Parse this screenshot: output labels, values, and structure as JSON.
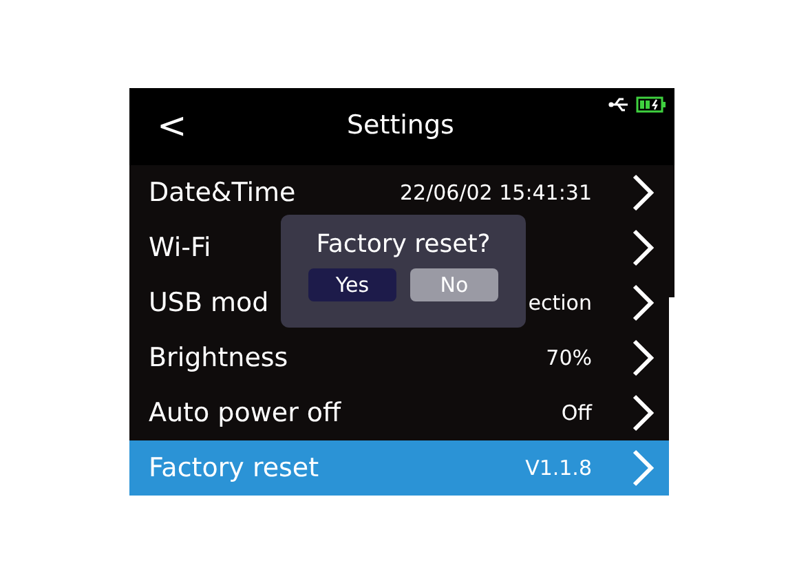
{
  "header": {
    "back": "<",
    "title": "Settings"
  },
  "rows": [
    {
      "label": "Date&Time",
      "value": "22/06/02 15:41:31",
      "selected": false
    },
    {
      "label": "Wi-Fi",
      "selected": false
    },
    {
      "label": "USB mod",
      "value": "ection",
      "selected": false
    },
    {
      "label": "Brightness",
      "value": "70%",
      "selected": false
    },
    {
      "label": "Auto power off",
      "value": "Off",
      "selected": false
    },
    {
      "label": "Factory reset",
      "value": "V1.1.8",
      "selected": true
    }
  ],
  "dialog": {
    "title": "Factory reset?",
    "buttons": [
      {
        "label": "Yes",
        "selected": false
      },
      {
        "label": "No",
        "selected": true
      }
    ]
  }
}
